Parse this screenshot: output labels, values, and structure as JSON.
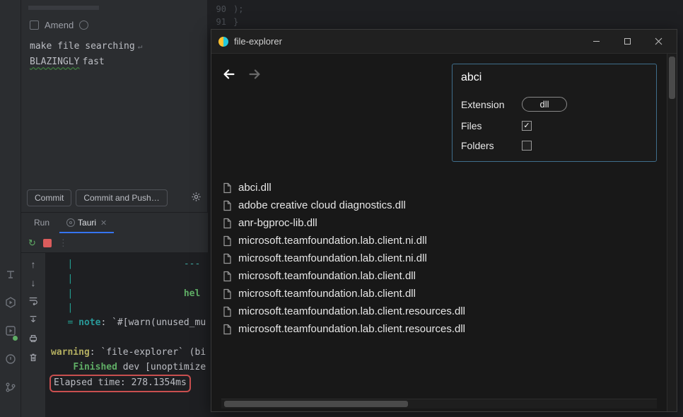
{
  "editor": {
    "lines": [
      {
        "num": "90",
        "code": ");"
      },
      {
        "num": "91",
        "code": "}"
      }
    ]
  },
  "commit": {
    "amend_label": "Amend",
    "msg_line1": "make file searching",
    "msg_line2_word": "BLAZINGLY",
    "msg_line2_rest": " fast",
    "commit_btn": "Commit",
    "commit_push_btn": "Commit and Push…"
  },
  "run": {
    "tab1": "Run",
    "tab2": "Tauri"
  },
  "console": {
    "l1_pipe": "|",
    "l1_dash": "---",
    "l2_pipe": "|",
    "l3_pipe": "|",
    "l3_hel": "hel",
    "l4_pipe": "|",
    "note_eq": "=",
    "note_label": " note",
    "note_rest": ": `#[warn(unused_mu",
    "warn_label": "warning",
    "warn_rest": ": `file-explorer` (bi",
    "finished_label": "Finished",
    "finished_rest": " dev [unoptimize",
    "elapsed": "Elapsed time: 278.1354ms"
  },
  "fe": {
    "title": "file-explorer",
    "search_value": "abci",
    "ext_label": "Extension",
    "ext_value": "dll",
    "files_label": "Files",
    "folders_label": "Folders",
    "results": [
      "abci.dll",
      "adobe creative cloud diagnostics.dll",
      "anr-bgproc-lib.dll",
      "microsoft.teamfoundation.lab.client.ni.dll",
      "microsoft.teamfoundation.lab.client.ni.dll",
      "microsoft.teamfoundation.lab.client.dll",
      "microsoft.teamfoundation.lab.client.dll",
      "microsoft.teamfoundation.lab.client.resources.dll",
      "microsoft.teamfoundation.lab.client.resources.dll"
    ]
  }
}
